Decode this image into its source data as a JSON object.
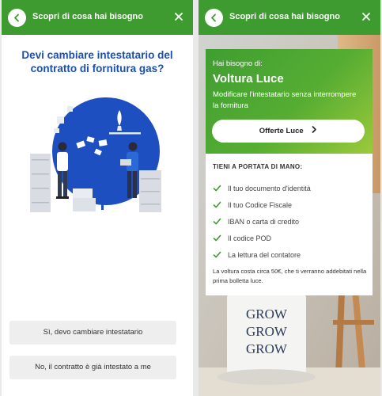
{
  "screens": [
    {
      "topbar": {
        "title": "Scopri di cosa hai bisogno"
      },
      "question": "Devi cambiare intestatario del contratto di fornitura gas?",
      "choices": [
        "Sì, devo cambiare intestatario",
        "No, il contratto è già intestato a me"
      ],
      "illustration": "two-people-office-documents-illustration"
    },
    {
      "topbar": {
        "title": "Scopri di cosa hai bisogno"
      },
      "hero": {
        "subtitle": "Hai bisogno di:",
        "title": "Voltura Luce",
        "description": "Modificare l'intestatario senza interrompere la fornitura",
        "button_label": "Offerte Luce"
      },
      "panel": {
        "heading": "TIENI A PORTATA DI MANO:",
        "items": [
          "Il tuo documento d'identità",
          "Il tuo Codice Fiscale",
          "IBAN o carta di credito",
          "Il codice POD",
          "La lettura del contatore"
        ],
        "note": "La voltura costa circa 50€, che ti verranno addebitati nella prima bolletta luce."
      },
      "background_mug_text": [
        "GROW",
        "GROW",
        "GROW"
      ]
    }
  ],
  "colors": {
    "brand_green": "#3e9b2f",
    "question_blue": "#1b4fae",
    "illustration_blue": "#1d4fc1"
  },
  "icons": [
    "back-arrow-icon",
    "close-icon",
    "chevron-right-icon",
    "check-icon"
  ]
}
